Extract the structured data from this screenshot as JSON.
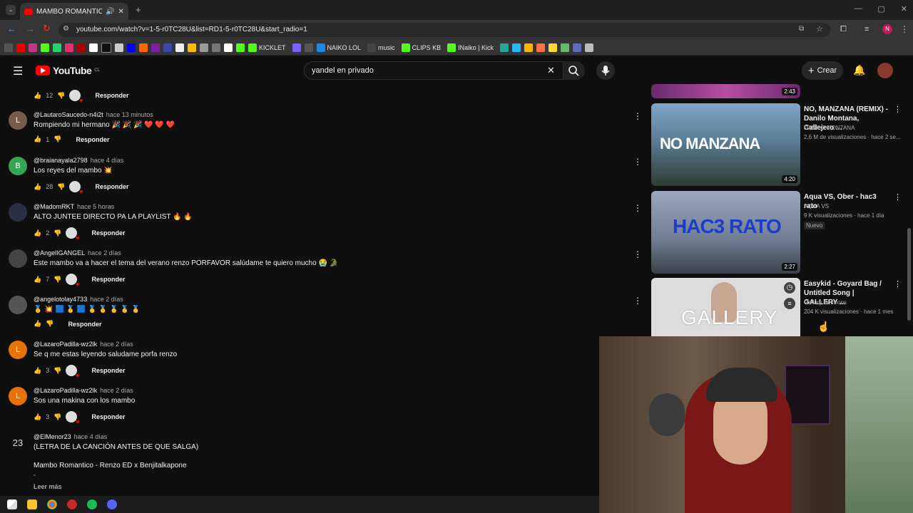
{
  "browser": {
    "tab_title": "MAMBO ROMANTICO - RE",
    "url": "youtube.com/watch?v=1-5-r0TC28U&list=RD1-5-r0TC28U&start_radio=1",
    "bookmarks": [
      "KICKLET",
      "NAIKO LOL",
      "music",
      "CLIPS KB",
      "INaiko | Kick"
    ],
    "profile_initial": "N"
  },
  "youtube": {
    "logo": "YouTube",
    "country": "CL",
    "search_value": "yandel en privado",
    "create_label": "Crear"
  },
  "comments": [
    {
      "handle": "",
      "time": "",
      "text": "",
      "likes": "12",
      "reply": "Responder",
      "avatar_letter": "",
      "avatar_color": "#0f0f0f",
      "top_only": true
    },
    {
      "handle": "@LautaroSaucedo-n4i2t",
      "time": "hace 13 minutos",
      "text": "Rompiendo mi hermano 🎉 🎉 🎉 ❤️ ❤️ ❤️",
      "likes": "1",
      "reply": "Responder",
      "avatar_letter": "L",
      "avatar_color": "#7a5a4a"
    },
    {
      "handle": "@braianayala2798",
      "time": "hace 4 días",
      "text": "Los reyes del mambo 💥",
      "likes": "28",
      "reply": "Responder",
      "avatar_letter": "B",
      "avatar_color": "#33a852"
    },
    {
      "handle": "@MadomRKT",
      "time": "hace 5 horas",
      "text": "ALTO JUNTEE DIRECTO PA LA PLAYLIST 🔥 🔥",
      "likes": "2",
      "reply": "Responder",
      "avatar_letter": "",
      "avatar_color": "#2b2f45"
    },
    {
      "handle": "@AngelIGANGEL",
      "time": "hace 2 días",
      "text": "Este mambo va a hacer el tema del verano renzo PORFAVOR salúdame te quiero mucho 😭 🐊",
      "likes": "7",
      "reply": "Responder",
      "avatar_letter": "",
      "avatar_color": "#444"
    },
    {
      "handle": "@angelotolay4733",
      "time": "hace 2 días",
      "text": "🥇 💥 🟦 🥇 🟦 🥇 🥇 🥇 🥇 🥇",
      "likes": "",
      "reply": "Responder",
      "avatar_letter": "",
      "avatar_color": "#555"
    },
    {
      "handle": "@LazaroPadilla-wz2lk",
      "time": "hace 2 días",
      "text": "Se q me estas leyendo saludame porfa renzo",
      "likes": "3",
      "reply": "Responder",
      "avatar_letter": "L",
      "avatar_color": "#e8710a"
    },
    {
      "handle": "@LazaroPadilla-wz2lk",
      "time": "hace 2 días",
      "text": "Sos una makina con los mambo",
      "likes": "3",
      "reply": "Responder",
      "avatar_letter": "L",
      "avatar_color": "#e8710a"
    },
    {
      "handle": "@ElMenor23",
      "time": "hace 4 días",
      "text": "(LETRA DE LA CANCIÓN ANTES DE QUE SALGA)",
      "text2": "Mambo Romantico - Renzo ED x Benjitalkapone",
      "more": "Leer más",
      "avatar_letter": "23",
      "avatar_color": "#0f0f0f"
    }
  ],
  "sidebar": [
    {
      "title": "",
      "channel": "",
      "meta": "",
      "duration": "2:43",
      "thumb_color": "#6a2a6e"
    },
    {
      "title": "NO, MANZANA (REMIX) - Danilo Montana, Callejero ...",
      "channel": "DANILO MONTANA",
      "meta": "2,6 M de visualizaciones · hace 2 se...",
      "duration": "4:20",
      "thumb_text": "NO MANZANA",
      "thumb_color": "#4f6f8a"
    },
    {
      "title": "Aqua VS, Ober - hac3 rato",
      "channel": "AQUA VS",
      "meta": "9 K visualizaciones · hace 1 día",
      "badge": "Nuevo",
      "duration": "2:27",
      "thumb_text": "HAC3 RATO",
      "thumb_color": "#7e8aa0"
    },
    {
      "title": "Easykid - Goyard Bag / Untitled Song | GALLERY ...",
      "channel": "Gallery Sessions",
      "meta": "204 K visualizaciones · hace 1 mes",
      "duration": "",
      "thumb_text": "GALLERY",
      "thumb_color": "#d8d8d8"
    }
  ],
  "taskbar": [
    "start",
    "explorer",
    "chrome",
    "app",
    "spotify",
    "discord"
  ]
}
